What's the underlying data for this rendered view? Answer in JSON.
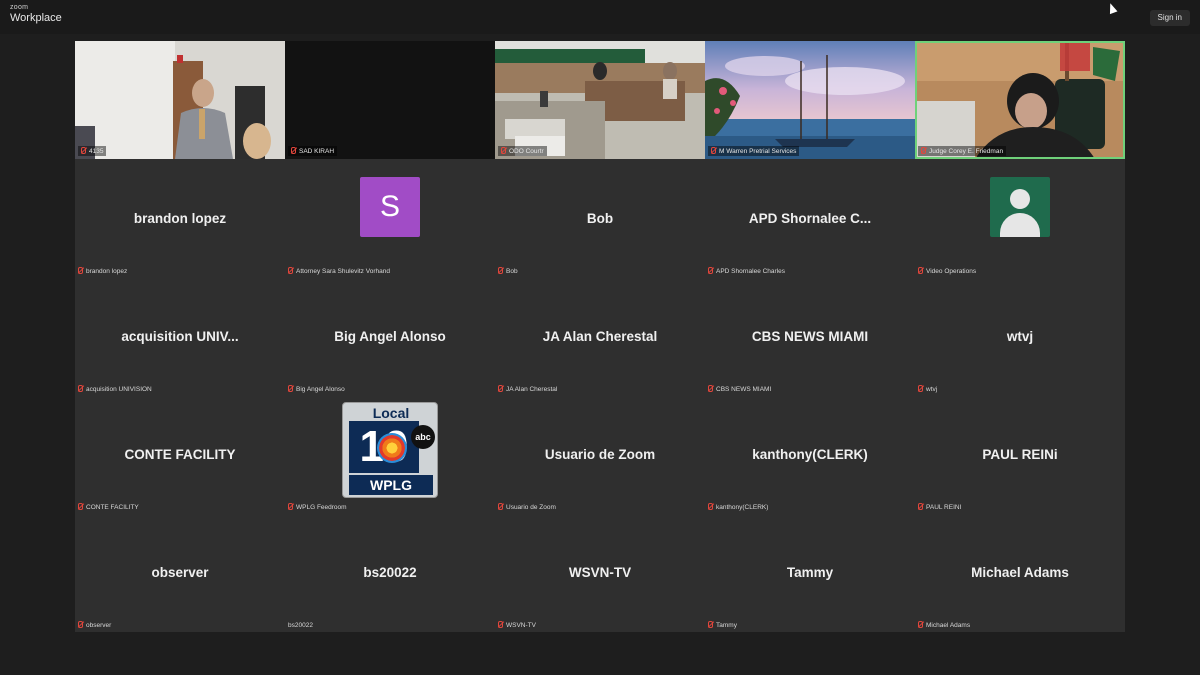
{
  "app": {
    "brand_small": "zoom",
    "brand_big": "Workplace",
    "signin_label": "Sign in"
  },
  "video_tiles": [
    {
      "label": "4135",
      "scene": "courtroom-attorney"
    },
    {
      "label": "SAD KIRAH",
      "scene": "black"
    },
    {
      "label": "ODO Courtr",
      "scene": "courtroom-wide"
    },
    {
      "label": "M Warren Pretrial Services",
      "scene": "sailboat-background"
    },
    {
      "label": "Judge Corey E. Friedman",
      "scene": "judge",
      "active": true
    }
  ],
  "participants": [
    {
      "name": "brandon lopez",
      "label": "brandon lopez"
    },
    {
      "name": "",
      "label": "Attorney Sara Shulevitz Vorhand",
      "avatar": "S"
    },
    {
      "name": "Bob",
      "label": "Bob"
    },
    {
      "name": "APD  Shornalee  C...",
      "label": "APD Shornalee Charles"
    },
    {
      "name": "",
      "label": "Video Operations",
      "avatar_icon": "user-icon"
    },
    {
      "name": "acquisition  UNIV...",
      "label": "acquisition UNIVISION"
    },
    {
      "name": "Big Angel Alonso",
      "label": "Big Angel Alonso"
    },
    {
      "name": "JA Alan Cherestal",
      "label": "JA Alan Cherestal"
    },
    {
      "name": "CBS NEWS MIAMI",
      "label": "CBS NEWS MIAMI"
    },
    {
      "name": "wtvj",
      "label": "wtvj"
    },
    {
      "name": "CONTE FACILITY",
      "label": "CONTE FACILITY"
    },
    {
      "name": "",
      "label": "WPLG Feedroom",
      "logo": {
        "top": "Local",
        "num": "10",
        "network": "abc",
        "bottom": "WPLG"
      }
    },
    {
      "name": "Usuario de Zoom",
      "label": "Usuario de Zoom"
    },
    {
      "name": "kanthony(CLERK)",
      "label": "kanthony(CLERK)"
    },
    {
      "name": "PAUL REINi",
      "label": "PAUL REINI"
    },
    {
      "name": "observer",
      "label": "observer"
    },
    {
      "name": "bs20022",
      "label": "bs20022"
    },
    {
      "name": "WSVN-TV",
      "label": "WSVN-TV"
    },
    {
      "name": "Tammy",
      "label": "Tammy"
    },
    {
      "name": "Michael Adams",
      "label": "Michael Adams"
    }
  ],
  "colors": {
    "active_speaker": "#6fd17a",
    "muted": "#e2463c",
    "avatar_purple": "#a14cc6",
    "avatar_green": "#1f6b4d"
  }
}
